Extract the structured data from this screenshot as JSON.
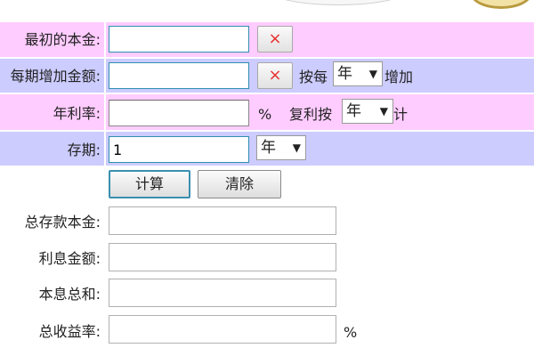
{
  "form": {
    "initial_principal": {
      "label": "最初的本金:",
      "value": ""
    },
    "periodic_add": {
      "label": "每期增加金额:",
      "value": "",
      "prefix": "按每",
      "unit": "年",
      "suffix": "增加"
    },
    "annual_rate": {
      "label": "年利率:",
      "value": "",
      "percent": "%",
      "compound_prefix": "复利按",
      "compound_unit": "年",
      "compound_suffix": "计"
    },
    "term": {
      "label": "存期:",
      "value": "1",
      "unit": "年"
    },
    "clear_symbol": "×",
    "dropdown_arrow": "▼"
  },
  "buttons": {
    "calculate": "计算",
    "reset": "清除"
  },
  "results": {
    "total_principal": {
      "label": "总存款本金:",
      "value": ""
    },
    "interest_amount": {
      "label": "利息金额:",
      "value": ""
    },
    "total_sum": {
      "label": "本息总和:",
      "value": ""
    },
    "total_yield": {
      "label": "总收益率:",
      "value": "",
      "percent": "%"
    }
  }
}
